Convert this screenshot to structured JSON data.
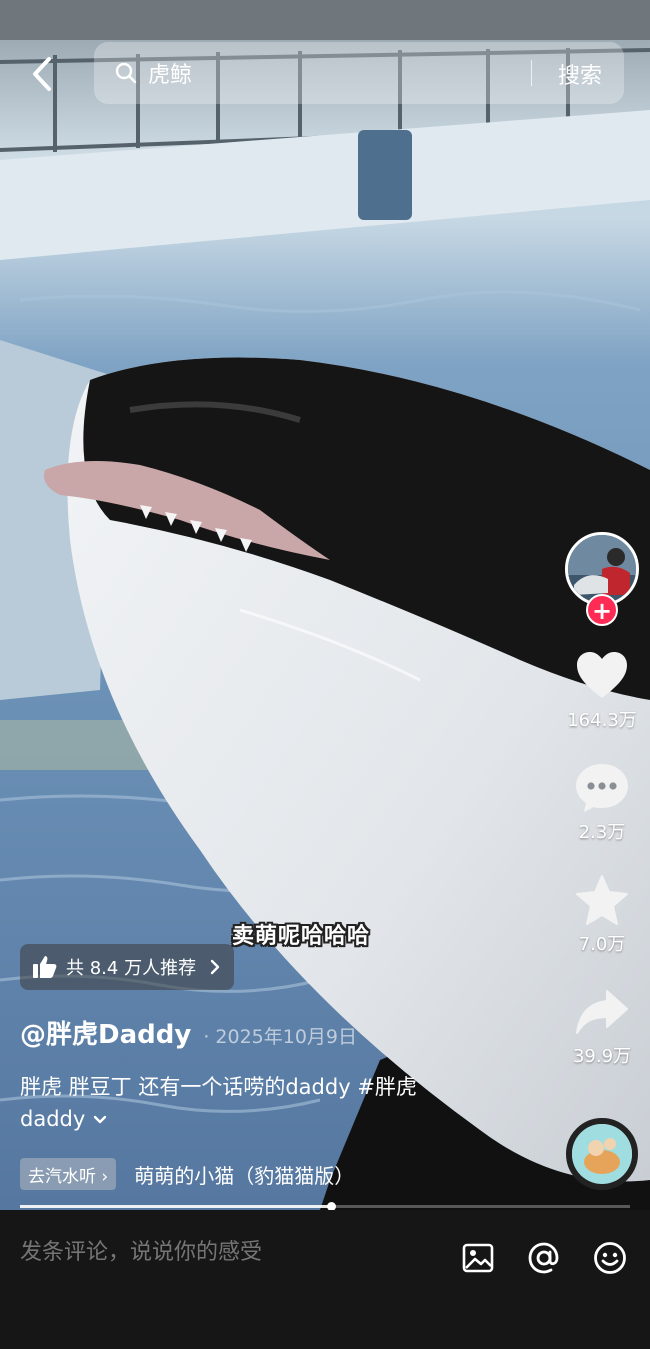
{
  "search": {
    "query": "虎鲸",
    "button_label": "搜索"
  },
  "icons": {
    "back": "back-arrow-icon",
    "search": "search-icon",
    "like": "heart-icon",
    "comment": "comment-bubble-icon",
    "favorite": "star-icon",
    "share": "share-arrow-icon",
    "image": "image-icon",
    "mention": "at-sign-icon",
    "emoji": "smiley-icon"
  },
  "colors": {
    "accent": "#fe2c55",
    "bottom_bar": "#161616"
  },
  "sidebar": {
    "follow_symbol": "+",
    "like_count": "164.3万",
    "comment_count": "2.3万",
    "favorite_count": "7.0万",
    "share_count": "39.9万"
  },
  "video": {
    "caption_overlay": "卖萌呢哈哈哈",
    "recommend_label": "共 8.4 万人推荐",
    "author": "@胖虎Daddy",
    "date": "· 2025年10月9日",
    "description_text": "胖虎 胖豆丁 还有一个话唠的daddy ",
    "hashtag": "#胖虎daddy",
    "music_tag": "去汽水听 ›",
    "music_title": "萌萌的小猫（豹猫猫版）",
    "progress": 0.51
  },
  "bottom": {
    "comment_placeholder": "发条评论，说说你的感受"
  }
}
